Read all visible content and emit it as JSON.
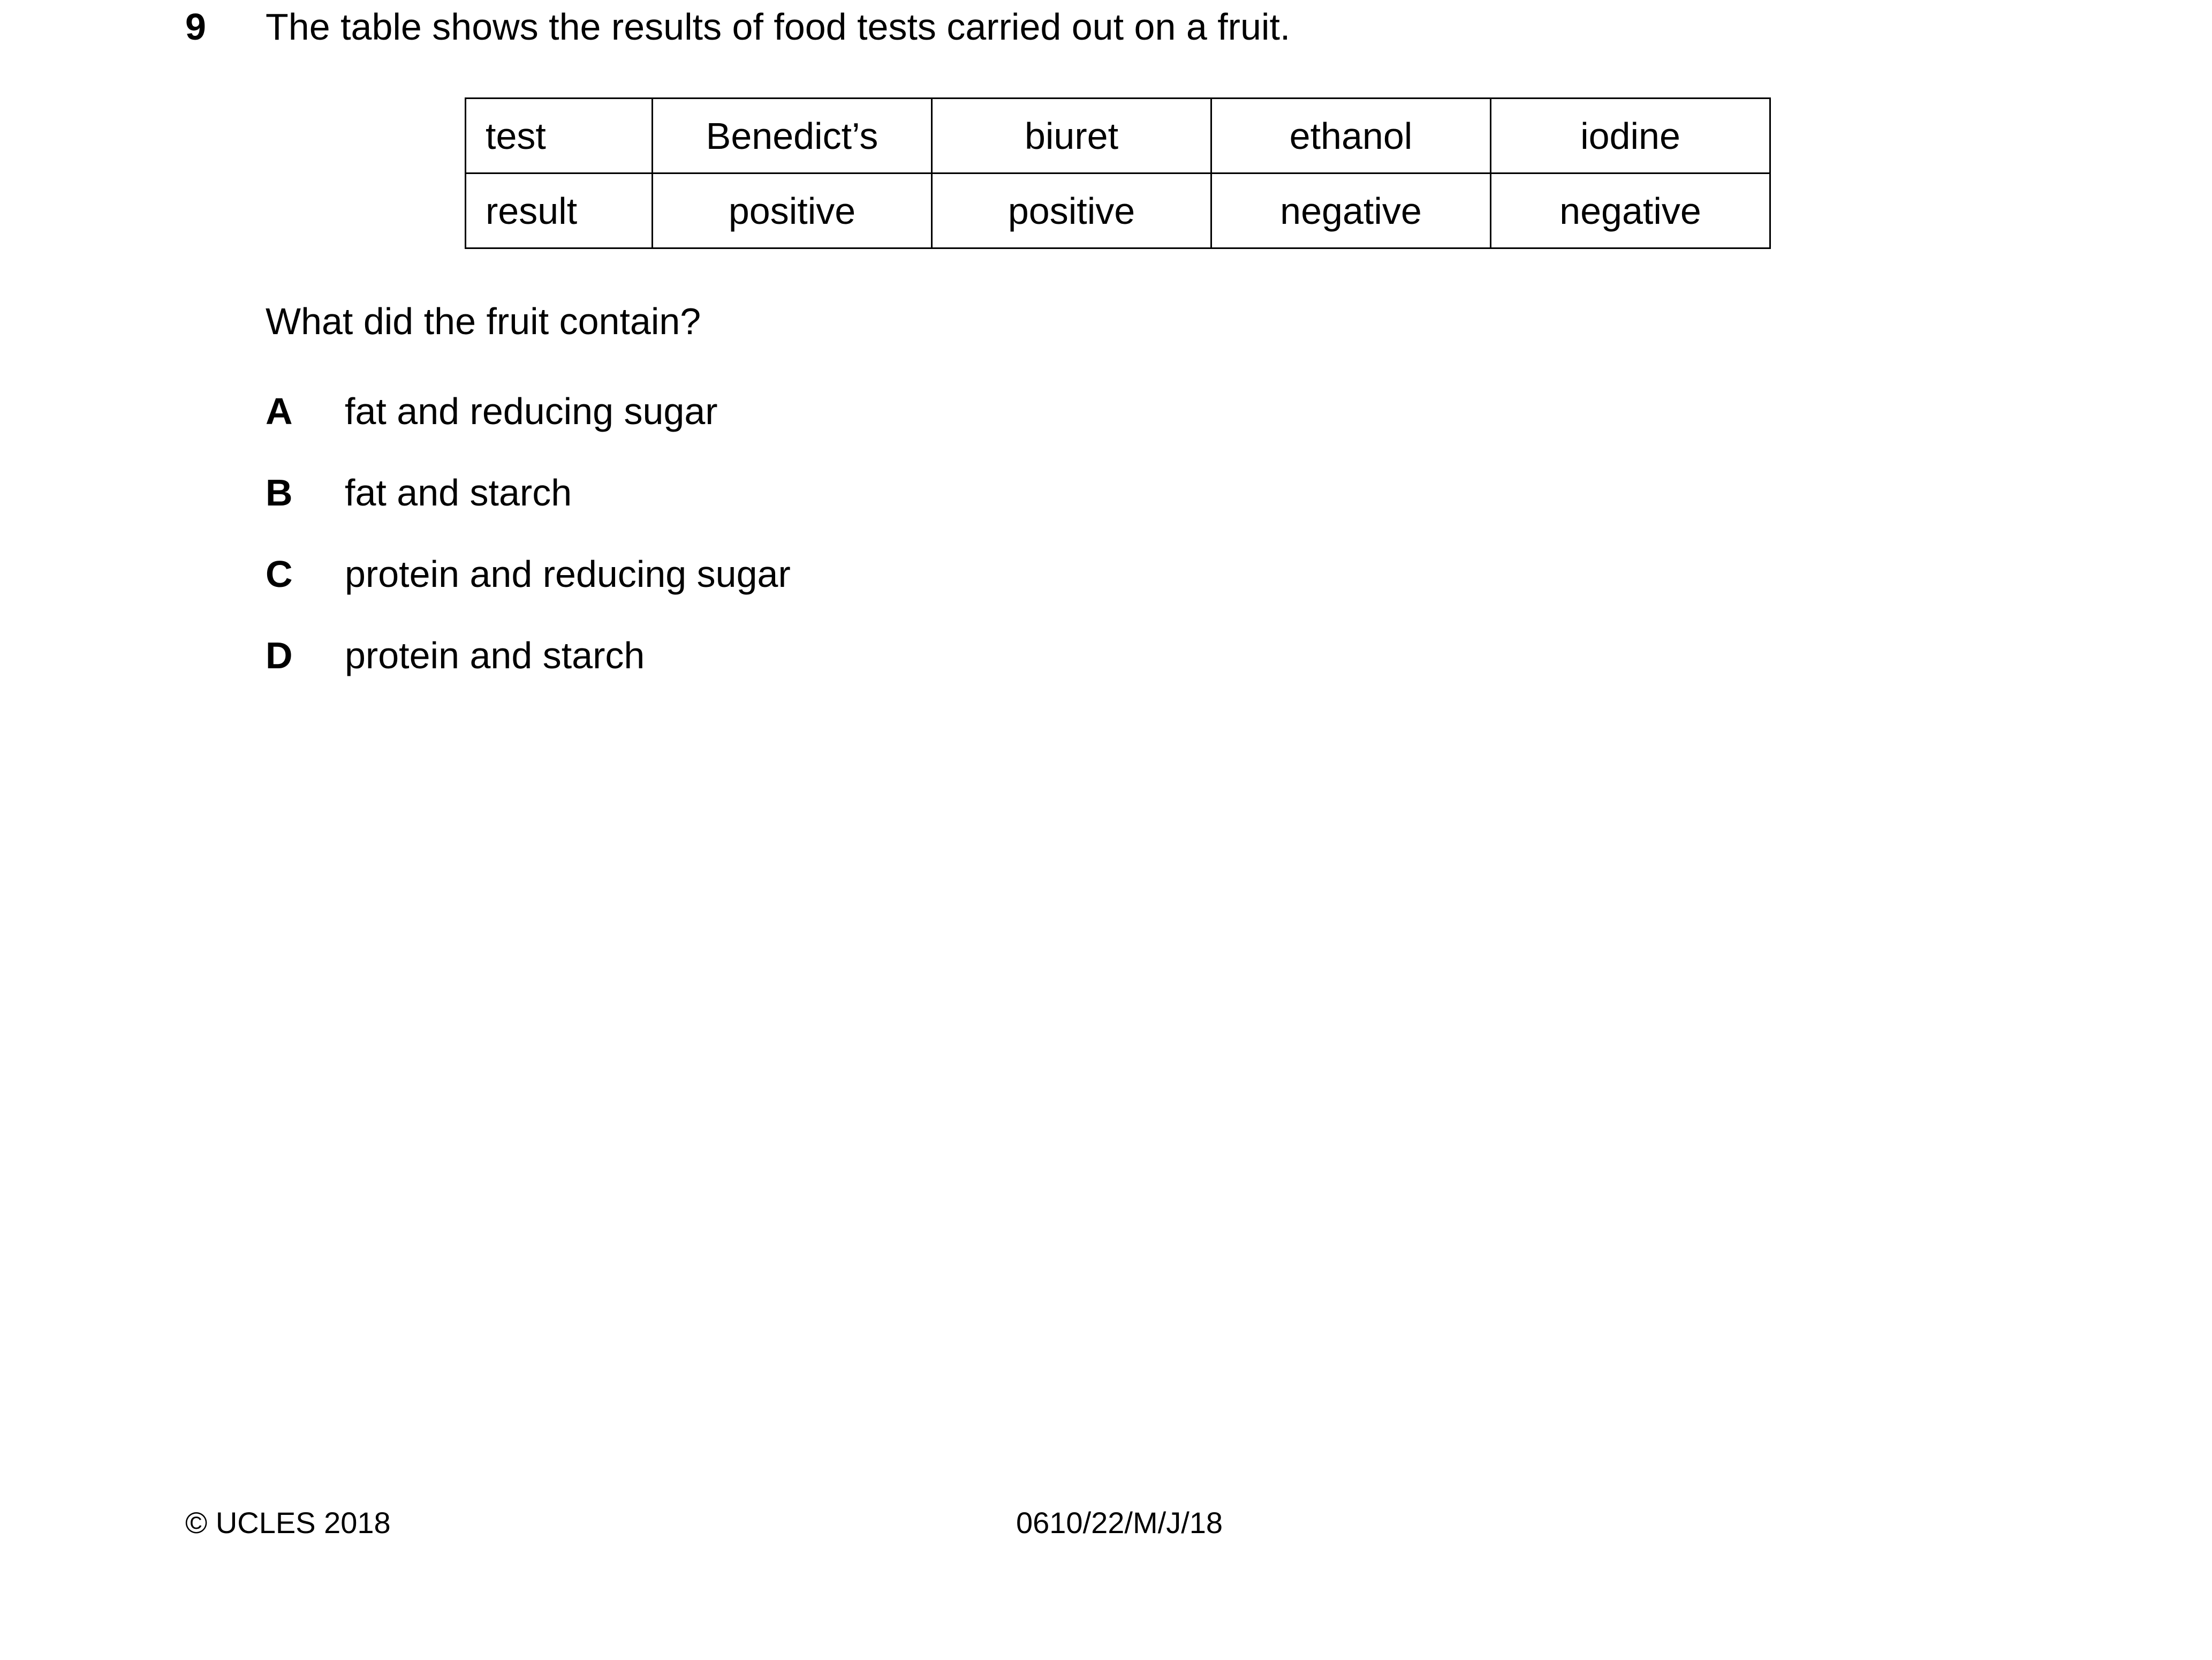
{
  "question": {
    "number": "9",
    "stem": "The table shows the results of food tests carried out on a fruit.",
    "table": {
      "rows": [
        [
          "test",
          "Benedict’s",
          "biuret",
          "ethanol",
          "iodine"
        ],
        [
          "result",
          "positive",
          "positive",
          "negative",
          "negative"
        ]
      ]
    },
    "prompt": "What did the fruit contain?",
    "options": [
      {
        "letter": "A",
        "text": "fat and reducing sugar"
      },
      {
        "letter": "B",
        "text": "fat and starch"
      },
      {
        "letter": "C",
        "text": "protein and reducing sugar"
      },
      {
        "letter": "D",
        "text": "protein and starch"
      }
    ]
  },
  "footer": {
    "copyright": "© UCLES 2018",
    "paper_code": "0610/22/M/J/18"
  }
}
